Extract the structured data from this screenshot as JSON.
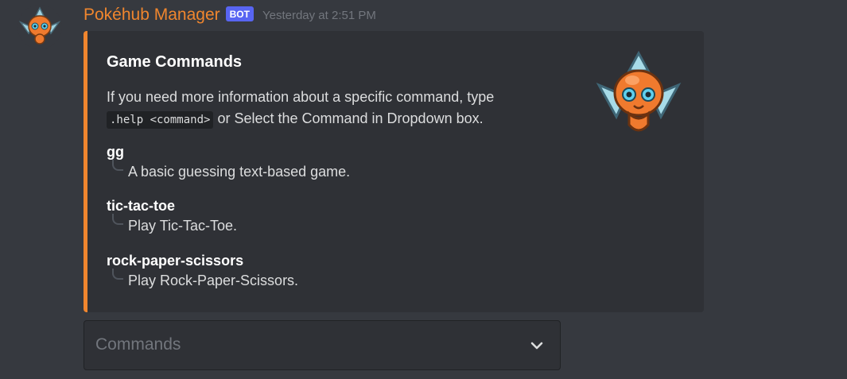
{
  "message": {
    "author": "Pokéhub Manager",
    "bot_tag": "BOT",
    "timestamp": "Yesterday at 2:51 PM",
    "avatar_icon": "rotom-avatar-icon",
    "accent_color": "#f0862e"
  },
  "embed": {
    "title": "Game Commands",
    "description_before": "If you need more information about a specific command, type",
    "description_code": ".help <command>",
    "description_after": " or Select the Command in Dropdown box.",
    "thumbnail_icon": "rotom-thumbnail-icon",
    "fields": [
      {
        "name": "gg",
        "value": "A basic guessing text-based game."
      },
      {
        "name": "tic-tac-toe",
        "value": "Play Tic-Tac-Toe."
      },
      {
        "name": "rock-paper-scissors",
        "value": "Play Rock-Paper-Scissors."
      }
    ]
  },
  "dropdown": {
    "placeholder": "Commands",
    "icon": "chevron-down-icon"
  }
}
